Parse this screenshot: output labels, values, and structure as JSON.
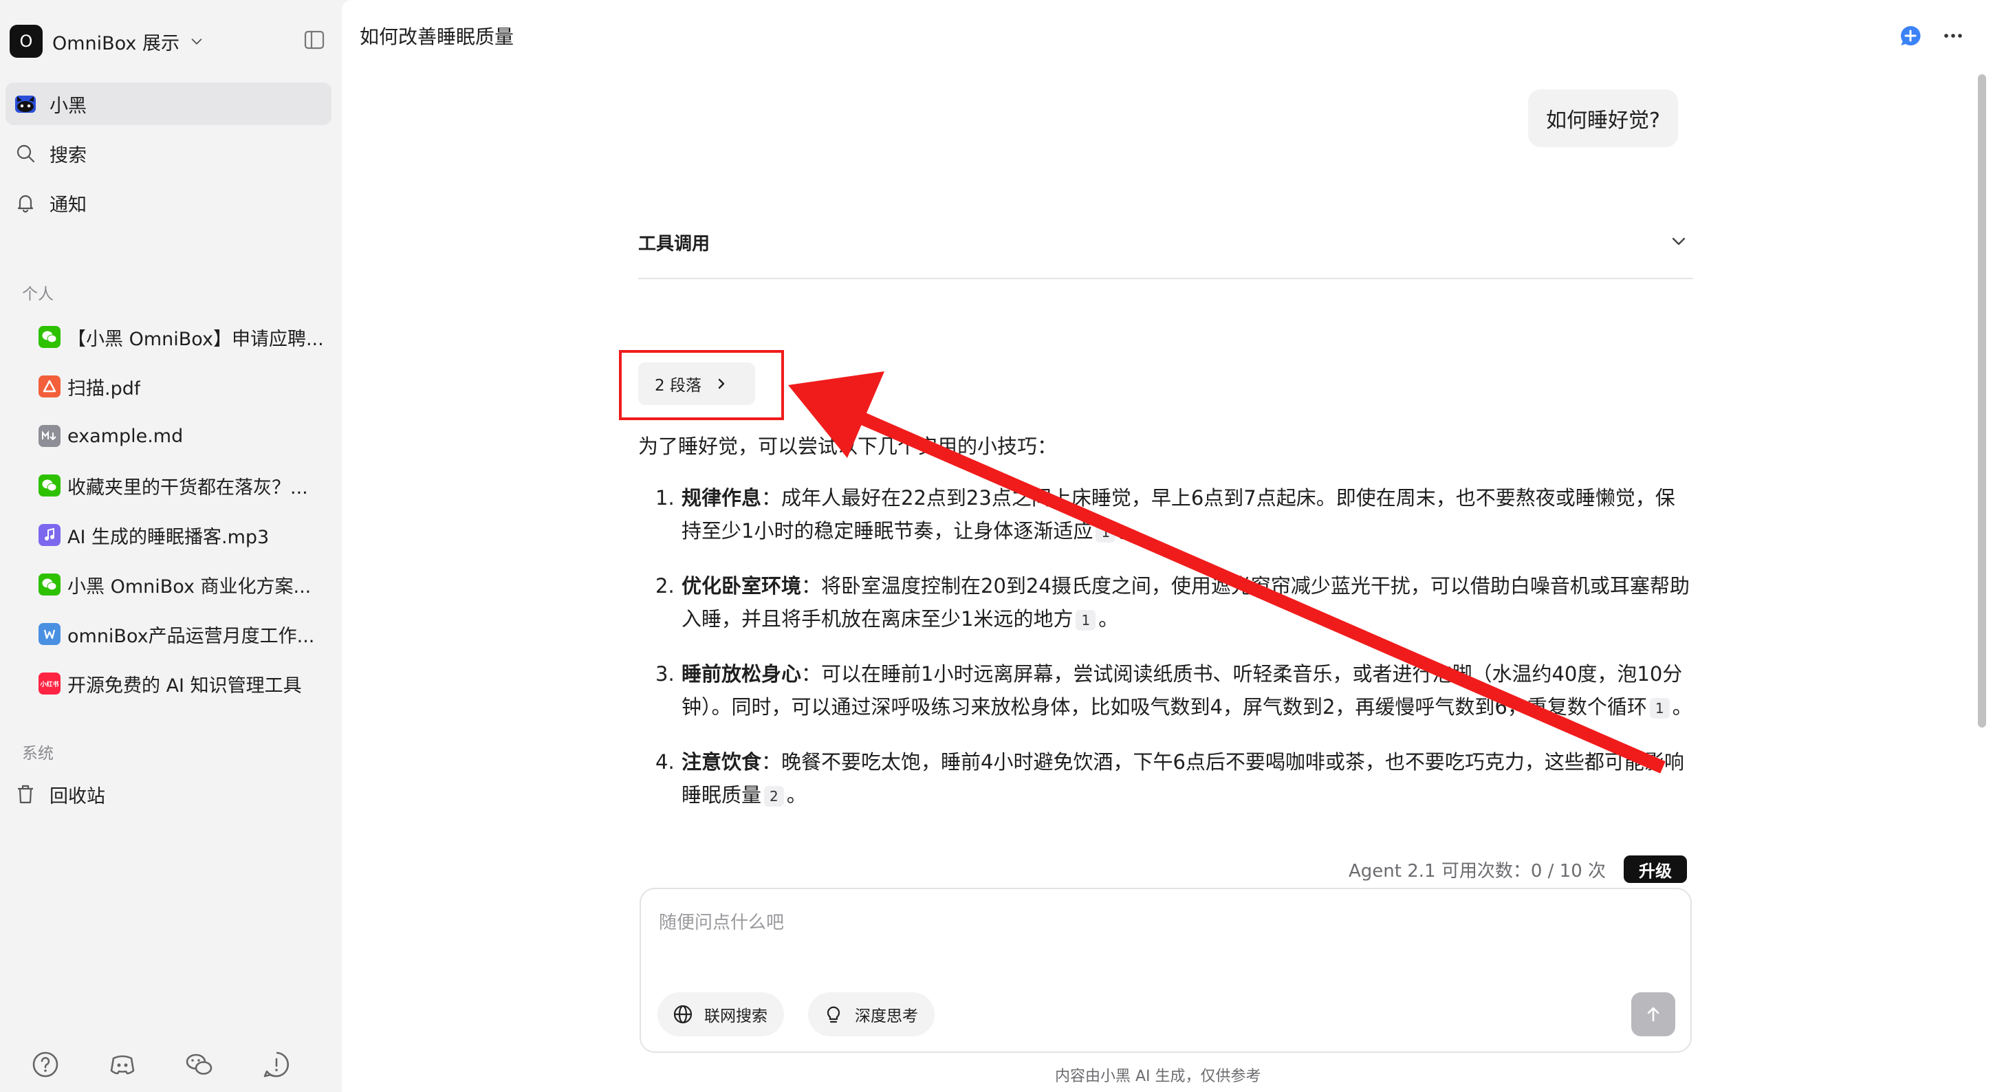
{
  "sidebar": {
    "workspace": {
      "logo_letter": "O",
      "name": "OmniBox 展示"
    },
    "nav": [
      {
        "label": "小黑",
        "icon": "cat-avatar-icon",
        "active": true
      },
      {
        "label": "搜索",
        "icon": "search-icon"
      },
      {
        "label": "通知",
        "icon": "bell-icon"
      }
    ],
    "personal_label": "个人",
    "docs": [
      {
        "label": "【小黑 OmniBox】申请应聘...",
        "icon": "wechat-icon",
        "color": "#2dc100"
      },
      {
        "label": "扫描.pdf",
        "icon": "pdf-icon",
        "color": "#f25f3a"
      },
      {
        "label": "example.md",
        "icon": "markdown-icon",
        "color": "#8e8e96"
      },
      {
        "label": "收藏夹里的干货都在落灰？...",
        "icon": "wechat-icon",
        "color": "#2dc100"
      },
      {
        "label": "AI 生成的睡眠播客.mp3",
        "icon": "audio-icon",
        "color": "#7b68ee"
      },
      {
        "label": "小黑 OmniBox 商业化方案...",
        "icon": "wechat-icon",
        "color": "#2dc100"
      },
      {
        "label": "omniBox产品运营月度工作...",
        "icon": "word-icon",
        "color": "#4a90e2"
      },
      {
        "label": "开源免费的 AI 知识管理工具",
        "icon": "xiaohongshu-icon",
        "color": "#ff2442",
        "badge_text": "小红书"
      }
    ],
    "system_label": "系统",
    "trash_label": "回收站"
  },
  "main": {
    "title": "如何改善睡眠质量",
    "user_message": "如何睡好觉?",
    "tool_call_label": "工具调用",
    "paragraph_chip": "2 段落",
    "intro": "为了睡好觉，可以尝试以下几个实用的小技巧：",
    "tips": [
      {
        "num": "1.",
        "title": "规律作息",
        "text": "：成年人最好在22点到23点之间上床睡觉，早上6点到7点起床。即使在周末，也不要熬夜或睡懒觉，保持至少1小时的稳定睡眠节奏，让身体逐渐适应",
        "cite": "1",
        "end": "。"
      },
      {
        "num": "2.",
        "title": "优化卧室环境",
        "text": "：将卧室温度控制在20到24摄氏度之间，使用遮光窗帘减少蓝光干扰，可以借助白噪音机或耳塞帮助入睡，并且将手机放在离床至少1米远的地方",
        "cite": "1",
        "end": "。"
      },
      {
        "num": "3.",
        "title": "睡前放松身心",
        "text": "：可以在睡前1小时远离屏幕，尝试阅读纸质书、听轻柔音乐，或者进行泡脚（水温约40度，泡10分钟）。同时，可以通过深呼吸练习来放松身体，比如吸气数到4，屏气数到2，再缓慢呼气数到6，重复数个循环",
        "cite": "1",
        "end": "。"
      },
      {
        "num": "4.",
        "title": "注意饮食",
        "text": "：晚餐不要吃太饱，睡前4小时避免饮酒，下午6点后不要喝咖啡或茶，也不要吃巧克力，这些都可能影响睡眠质量",
        "cite": "2",
        "end": "。"
      }
    ],
    "quota_text": "Agent 2.1 可用次数：0 / 10 次",
    "upgrade_label": "升级",
    "composer": {
      "placeholder": "随便问点什么吧",
      "web_search_label": "联网搜索",
      "deep_think_label": "深度思考"
    },
    "footer_note": "内容由小黑 AI 生成，仅供参考"
  },
  "colors": {
    "annotation_red": "#f01c1c",
    "accent_blue": "#3b82f6"
  }
}
